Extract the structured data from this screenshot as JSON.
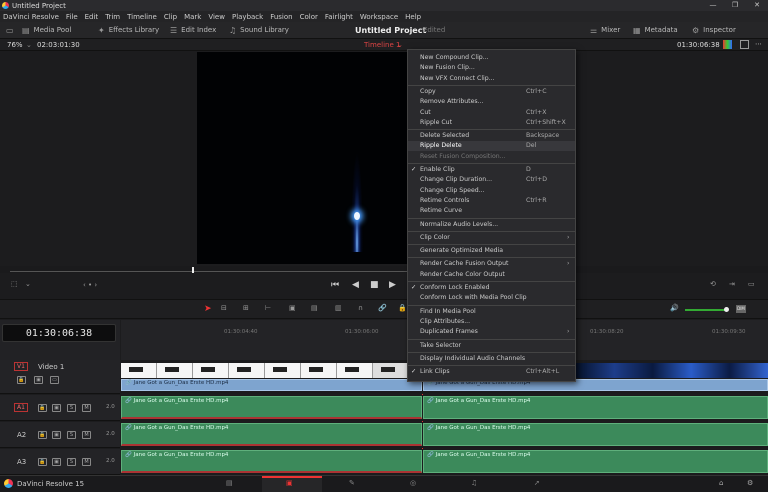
{
  "window": {
    "title": "Untitled Project"
  },
  "menubar": [
    "DaVinci Resolve",
    "File",
    "Edit",
    "Trim",
    "Timeline",
    "Clip",
    "Mark",
    "View",
    "Playback",
    "Fusion",
    "Color",
    "Fairlight",
    "Workspace",
    "Help"
  ],
  "toolbar": {
    "media_pool": "Media Pool",
    "effects": "Effects Library",
    "edit_index": "Edit Index",
    "sound_library": "Sound Library",
    "project_title": "Untitled Project",
    "project_status": "Edited",
    "mixer": "Mixer",
    "metadata": "Metadata",
    "inspector": "Inspector"
  },
  "viewer": {
    "zoom": "76%",
    "source_timecode": "02:03:01:30",
    "timeline_name": "Timeline 1",
    "record_timecode": "01:30:06:38"
  },
  "timeline": {
    "timecode": "01:30:06:38",
    "ruler_ticks": [
      "01:30:04:40",
      "01:30:06:00",
      "01:30:08:20",
      "01:30:09:30"
    ],
    "tracks": [
      {
        "id": "V1",
        "name": "Video 1"
      },
      {
        "id": "A1",
        "volume": "2.0"
      },
      {
        "id": "A2",
        "volume": "2.0"
      },
      {
        "id": "A3",
        "volume": "2.0"
      }
    ],
    "clip_name": "Jane Got a Gun_Das Erste HD.mp4",
    "audio_solo": "S",
    "audio_mute": "M"
  },
  "context_menu": [
    {
      "label": "New Compound Clip...",
      "shortcut": "",
      "disabled": false
    },
    {
      "label": "New Fusion Clip...",
      "shortcut": "",
      "disabled": false
    },
    {
      "label": "New VFX Connect Clip...",
      "shortcut": "",
      "disabled": false
    },
    {
      "sep": true
    },
    {
      "label": "Copy",
      "shortcut": "Ctrl+C",
      "disabled": false
    },
    {
      "label": "Remove Attributes...",
      "shortcut": "",
      "disabled": false
    },
    {
      "label": "Cut",
      "shortcut": "Ctrl+X",
      "disabled": false
    },
    {
      "label": "Ripple Cut",
      "shortcut": "Ctrl+Shift+X",
      "disabled": false
    },
    {
      "sep": true
    },
    {
      "label": "Delete Selected",
      "shortcut": "Backspace",
      "disabled": false
    },
    {
      "label": "Ripple Delete",
      "shortcut": "Del",
      "disabled": false,
      "highlight": true
    },
    {
      "label": "Reset Fusion Composition...",
      "shortcut": "",
      "disabled": true
    },
    {
      "sep": true
    },
    {
      "label": "Enable Clip",
      "shortcut": "D",
      "check": true
    },
    {
      "label": "Change Clip Duration...",
      "shortcut": "Ctrl+D"
    },
    {
      "label": "Change Clip Speed..."
    },
    {
      "label": "Retime Controls",
      "shortcut": "Ctrl+R"
    },
    {
      "label": "Retime Curve"
    },
    {
      "sep": true
    },
    {
      "label": "Normalize Audio Levels..."
    },
    {
      "sep": true
    },
    {
      "label": "Clip Color",
      "submenu": true
    },
    {
      "sep": true
    },
    {
      "label": "Generate Optimized Media"
    },
    {
      "sep": true
    },
    {
      "label": "Render Cache Fusion Output",
      "submenu": true
    },
    {
      "label": "Render Cache Color Output"
    },
    {
      "sep": true
    },
    {
      "label": "Conform Lock Enabled",
      "check": true
    },
    {
      "label": "Conform Lock with Media Pool Clip"
    },
    {
      "sep": true
    },
    {
      "label": "Find In Media Pool"
    },
    {
      "label": "Clip Attributes..."
    },
    {
      "label": "Duplicated Frames",
      "submenu": true
    },
    {
      "sep": true
    },
    {
      "label": "Take Selector"
    },
    {
      "sep": true
    },
    {
      "label": "Display Individual Audio Channels"
    },
    {
      "sep": true
    },
    {
      "label": "Link Clips",
      "shortcut": "Ctrl+Alt+L",
      "check": true
    }
  ],
  "statusbar": {
    "app": "DaVinci Resolve 15"
  }
}
